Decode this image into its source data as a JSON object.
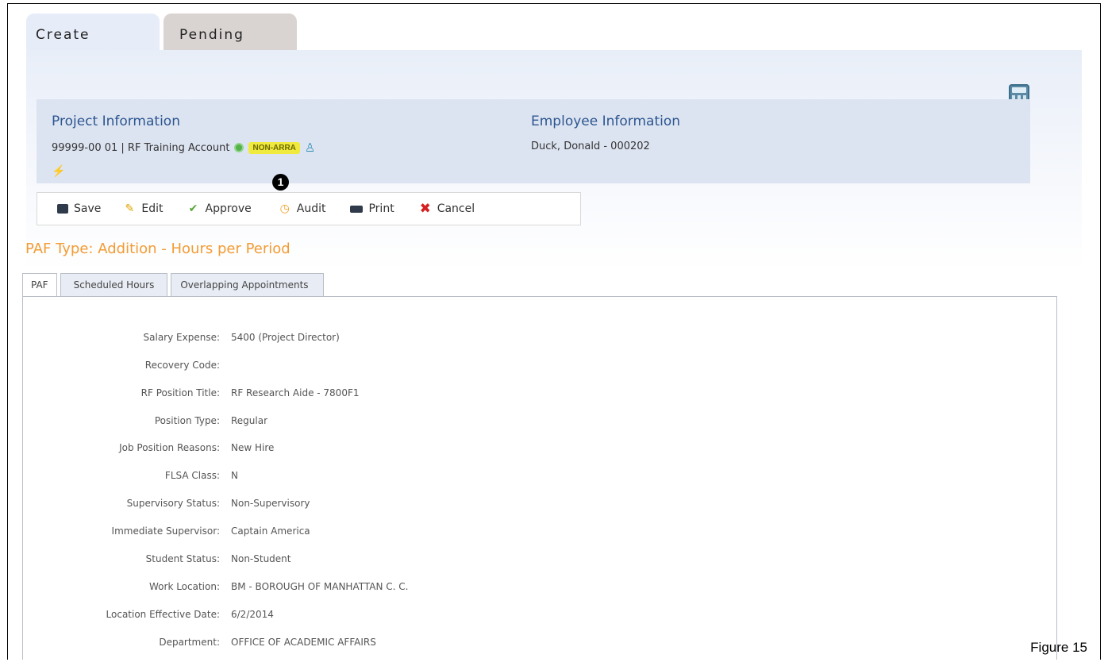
{
  "top_tabs": {
    "create": "Create",
    "pending": "Pending"
  },
  "project": {
    "title": "Project Information",
    "account": "99999-00 01 | RF Training Account",
    "badge": "NON-ARRA"
  },
  "employee": {
    "title": "Employee Information",
    "name": "Duck, Donald - 000202"
  },
  "callout": "1",
  "toolbar": {
    "save": "Save",
    "edit": "Edit",
    "approve": "Approve",
    "audit": "Audit",
    "print": "Print",
    "cancel": "Cancel"
  },
  "paf_type": "PAF Type: Addition - Hours per Period",
  "sub_tabs": [
    "PAF",
    "Scheduled Hours",
    "Overlapping Appointments"
  ],
  "fields": [
    {
      "label": "Salary Expense:",
      "value": "5400 (Project Director)"
    },
    {
      "label": "Recovery Code:",
      "value": ""
    },
    {
      "label": "RF Position Title:",
      "value": "RF Research Aide - 7800F1"
    },
    {
      "label": "Position Type:",
      "value": "Regular"
    },
    {
      "label": "Job Position Reasons:",
      "value": "New Hire"
    },
    {
      "label": "FLSA Class:",
      "value": "N"
    },
    {
      "label": "Supervisory Status:",
      "value": "Non-Supervisory"
    },
    {
      "label": "Immediate Supervisor:",
      "value": "Captain America"
    },
    {
      "label": "Student Status:",
      "value": "Non-Student"
    },
    {
      "label": "Work Location:",
      "value": "BM - BOROUGH OF MANHATTAN C. C."
    },
    {
      "label": "Location Effective Date:",
      "value": "6/2/2014"
    },
    {
      "label": "Department:",
      "value": "OFFICE OF ACADEMIC AFFAIRS"
    }
  ],
  "figure_label": "Figure 15",
  "colors": {
    "accent_blue": "#2c5690",
    "paf_orange": "#f39c34",
    "badge_yellow": "#f0ea3e"
  }
}
